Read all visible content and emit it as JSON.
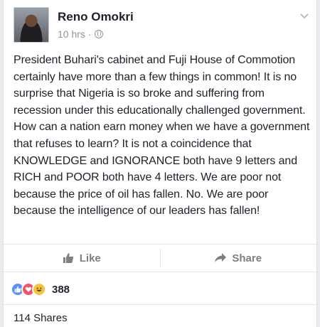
{
  "post": {
    "author": "Reno Omokri",
    "time": "10 hrs",
    "separator": "·",
    "text": "President Buhari's cabinet and Fuji House of Commotion certainly have more than a few things in common! It is no surprise that Nigeria is so broke and suffering from recession under this educationally challenged government. How can a nation earn money when we have a government that refuses to learn? It is not a coincidence that KNOWLEDGE and IGNORANCE both have 9 letters and RICH and POOR both have 4 letters. We are poor not because the price of oil has fallen. No. We are poor because the intelligence of our leaders has fallen!"
  },
  "actions": {
    "like_label": "Like",
    "share_label": "Share"
  },
  "reactions": {
    "icons": [
      "like-icon",
      "love-icon",
      "haha-icon"
    ],
    "count": "388"
  },
  "shares": {
    "label": "114 Shares"
  },
  "colors": {
    "accent": "#5890ff",
    "love": "#f25268",
    "haha": "#f7c23f",
    "muted": "#90949c"
  }
}
